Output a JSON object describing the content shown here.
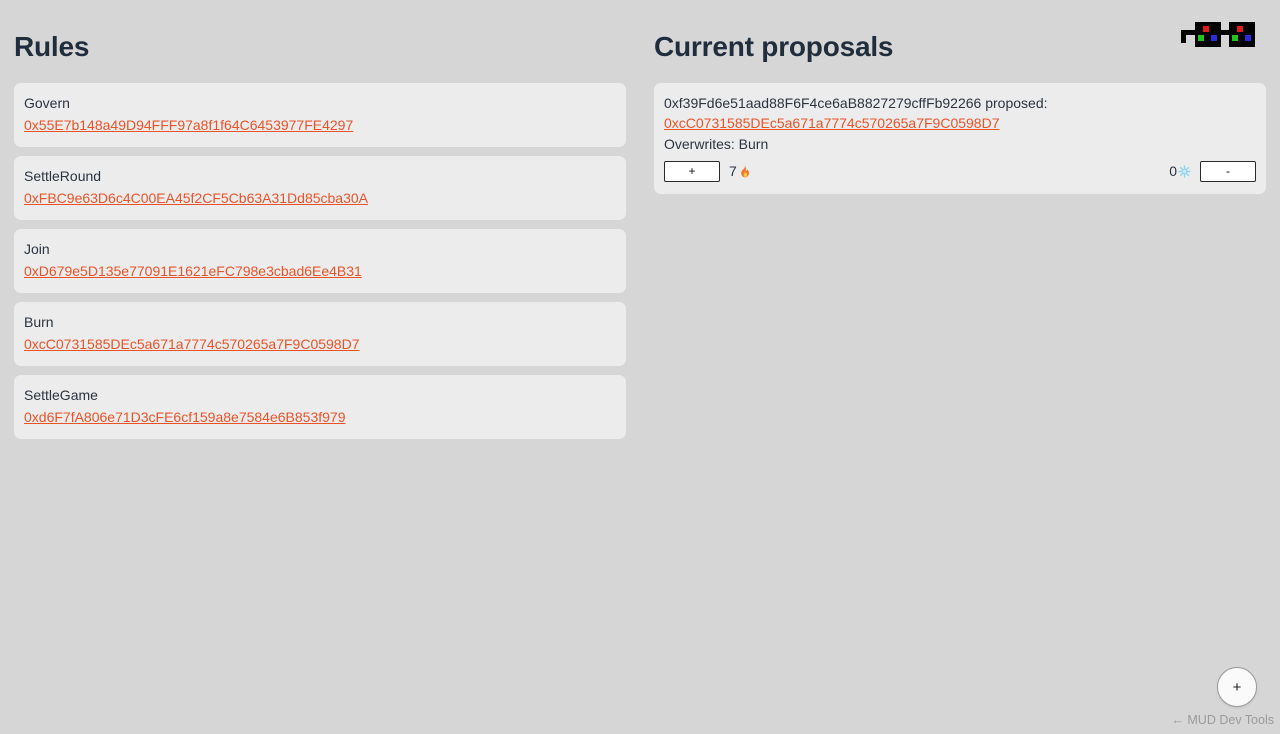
{
  "page": {
    "background_color": "#d6d6d6",
    "accent_link_color": "#e8542a",
    "heading_color": "#1f2d3d",
    "card_color": "#ececec"
  },
  "rules": {
    "title": "Rules",
    "items": [
      {
        "label": "Govern",
        "address": "0x55E7b148a49D94FFF97a8f1f64C6453977FE4297"
      },
      {
        "label": "SettleRound",
        "address": "0xFBC9e63D6c4C00EA45f2CF5Cb63A31Dd85cba30A"
      },
      {
        "label": "Join",
        "address": "0xD679e5D135e77091E1621eFC798e3cbad6Ee4B31"
      },
      {
        "label": "Burn",
        "address": "0xcC0731585DEc5a671a7774c570265a7F9C0598D7"
      },
      {
        "label": "SettleGame",
        "address": "0xd6F7fA806e71D3cFE6cf159a8e7584e6B853f979"
      }
    ]
  },
  "proposals": {
    "title": "Current proposals",
    "items": [
      {
        "proposer_line": "0xf39Fd6e51aad88F6F4ce6aB8827279cffFb92266 proposed:",
        "target_address": "0xcC0731585DEc5a671a7774c570265a7F9C0598D7",
        "overwrites": "Overwrites: Burn",
        "upvote_label": "+",
        "upvote_count": "7",
        "upvote_icon": "fire-icon",
        "downvote_label": "-",
        "downvote_count": "0",
        "downvote_icon": "snowflake-icon"
      }
    ]
  },
  "logo": {
    "name": "pixel-blocks-logo",
    "dot_colors": [
      "#e01b1b",
      "#1fc21f",
      "#2b2bdd"
    ],
    "body_color": "#000000"
  },
  "devtools": {
    "button_label": "+",
    "label": "← MUD Dev Tools"
  }
}
